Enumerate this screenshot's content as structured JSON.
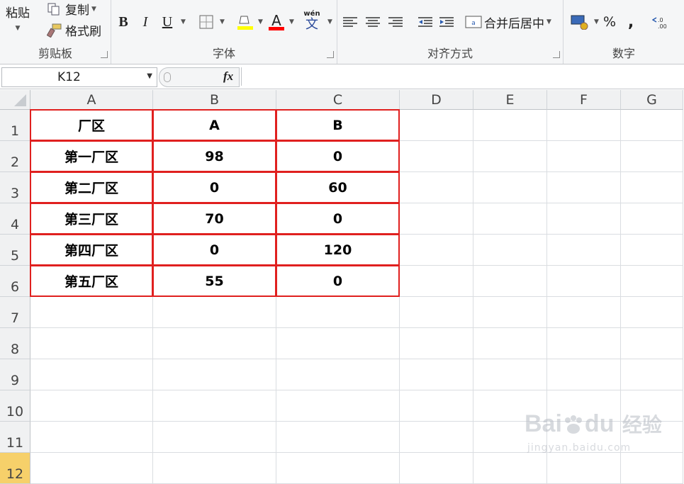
{
  "ribbon": {
    "clipboard": {
      "paste": "粘贴",
      "copy": "复制",
      "format_painter": "格式刷",
      "label": "剪贴板"
    },
    "font": {
      "bold": "B",
      "italic": "I",
      "underline": "U",
      "font_color_letter": "A",
      "phonetic_top": "wén",
      "phonetic_char": "文",
      "label": "字体",
      "fill_color": "#ffff00",
      "text_color": "#ff0000"
    },
    "alignment": {
      "merge_center": "合并后居中",
      "label": "对齐方式"
    },
    "number": {
      "percent": "%",
      "comma": ",",
      "label": "数字"
    }
  },
  "formula_bar": {
    "cell_ref": "K12",
    "fx": "fx",
    "content": ""
  },
  "sheet": {
    "columns": [
      "A",
      "B",
      "C",
      "D",
      "E",
      "F",
      "G"
    ],
    "rows": [
      "1",
      "2",
      "3",
      "4",
      "5",
      "6",
      "7",
      "8",
      "9",
      "10",
      "11",
      "12"
    ],
    "table": [
      [
        "厂区",
        "A",
        "B"
      ],
      [
        "第一厂区",
        "98",
        "0"
      ],
      [
        "第二厂区",
        "0",
        "60"
      ],
      [
        "第三厂区",
        "70",
        "0"
      ],
      [
        "第四厂区",
        "0",
        "120"
      ],
      [
        "第五厂区",
        "55",
        "0"
      ]
    ],
    "border_color": "#e0201f"
  },
  "watermark": {
    "brand": "Bai",
    "brand2": "du",
    "product": "经验",
    "url": "jingyan.baidu.com"
  }
}
